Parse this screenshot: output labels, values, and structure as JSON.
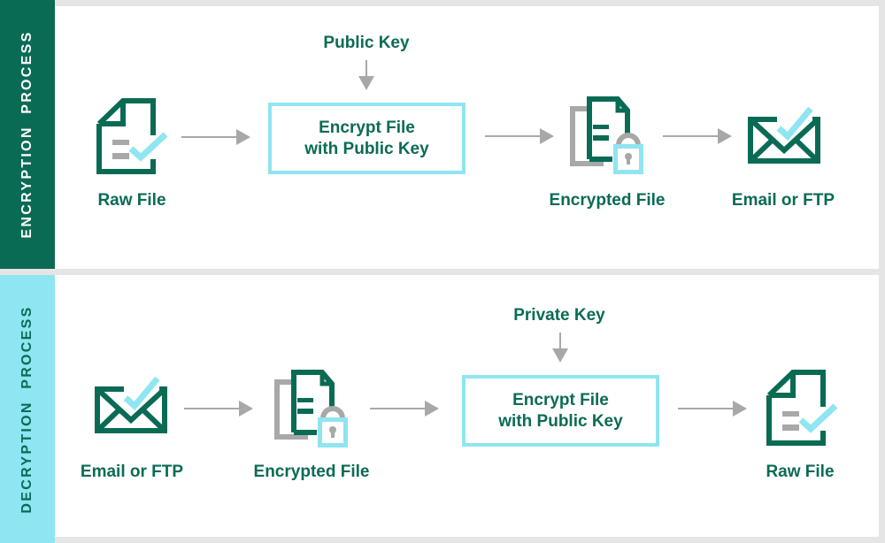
{
  "colors": {
    "brand_green": "#0a6b55",
    "accent_cyan": "#8fe5f1",
    "arrow_grey": "#a8a8a8",
    "background_grey": "#e5e5e5"
  },
  "encryption": {
    "title": "ENCRYPTION  PROCESS",
    "key_label": "Public Key",
    "process_box": {
      "line1": "Encrypt File",
      "line2": "with Public Key"
    },
    "steps": [
      {
        "label": "Raw File",
        "icon": "raw-file-icon"
      },
      {
        "label": "Encrypted File",
        "icon": "encrypted-file-icon"
      },
      {
        "label": "Email or FTP",
        "icon": "email-icon"
      }
    ]
  },
  "decryption": {
    "title": "DECRYPTION  PROCESS",
    "key_label": "Private Key",
    "process_box": {
      "line1": "Encrypt File",
      "line2": "with Public Key"
    },
    "steps": [
      {
        "label": "Email or FTP",
        "icon": "email-icon"
      },
      {
        "label": "Encrypted File",
        "icon": "encrypted-file-icon"
      },
      {
        "label": "Raw File",
        "icon": "raw-file-icon"
      }
    ]
  }
}
